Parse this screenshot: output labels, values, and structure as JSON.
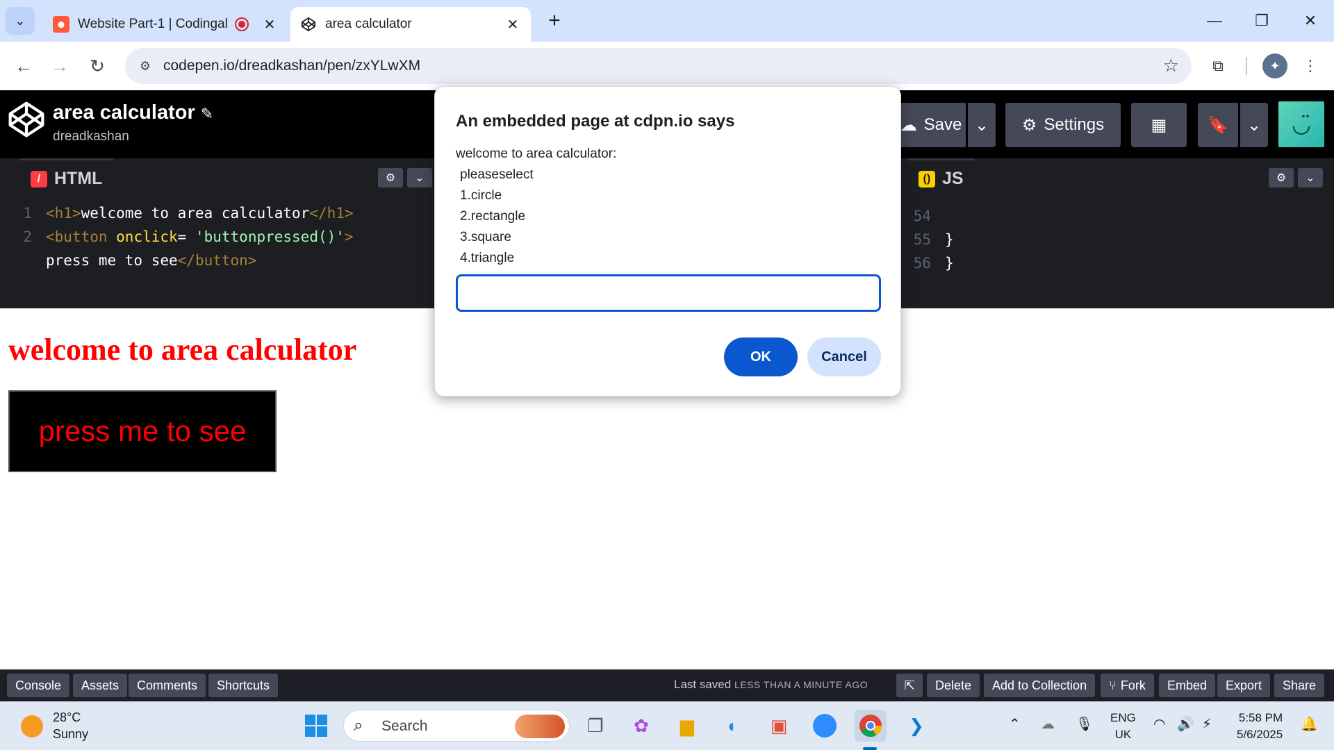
{
  "browser": {
    "tabs": [
      {
        "title": "Website Part-1 | Codingal",
        "favicon": "codingal-icon",
        "recording": true
      },
      {
        "title": "area calculator",
        "favicon": "codepen-icon",
        "active": true
      }
    ],
    "url": "codepen.io/dreadkashan/pen/zxYLwXM"
  },
  "codepen": {
    "pen_title": "area calculator",
    "username": "dreadkashan",
    "save_label": "Save",
    "settings_label": "Settings"
  },
  "editors": {
    "html": {
      "label": "HTML",
      "lines": [
        {
          "no": "1",
          "code": "<h1>welcome to area calculator</h1>"
        },
        {
          "no": "2",
          "code": "<button onclick= 'buttonpressed()'>"
        },
        {
          "no": "",
          "code": "press me to see</button>"
        }
      ]
    },
    "js": {
      "label": "JS",
      "lines": [
        {
          "no": "54",
          "code": ""
        },
        {
          "no": "55",
          "code": "}"
        },
        {
          "no": "56",
          "code": "}"
        }
      ]
    }
  },
  "preview": {
    "heading": "welcome to area calculator",
    "button_label": "press me to see"
  },
  "dialog": {
    "title": "An embedded page at cdpn.io says",
    "message_lines": [
      "welcome to area calculator:",
      "pleaseselect",
      "1.circle",
      "2.rectangle",
      "3.square",
      "4.triangle"
    ],
    "input_value": "",
    "ok_label": "OK",
    "cancel_label": "Cancel"
  },
  "footer": {
    "left_buttons": [
      "Console",
      "Assets",
      "Comments",
      "Shortcuts"
    ],
    "last_saved_label": "Last saved",
    "last_saved_time": "LESS THAN A MINUTE AGO",
    "right_buttons": [
      "Delete",
      "Add to Collection",
      "Fork",
      "Embed",
      "Export",
      "Share"
    ]
  },
  "taskbar": {
    "temperature": "28°C",
    "condition": "Sunny",
    "search_label": "Search",
    "language": "ENG",
    "region": "UK",
    "time": "5:58 PM",
    "date": "5/6/2025"
  },
  "colors": {
    "preview_text": "#ff0000",
    "dialog_accent": "#0b57d0",
    "codepen_bg": "#000000"
  }
}
